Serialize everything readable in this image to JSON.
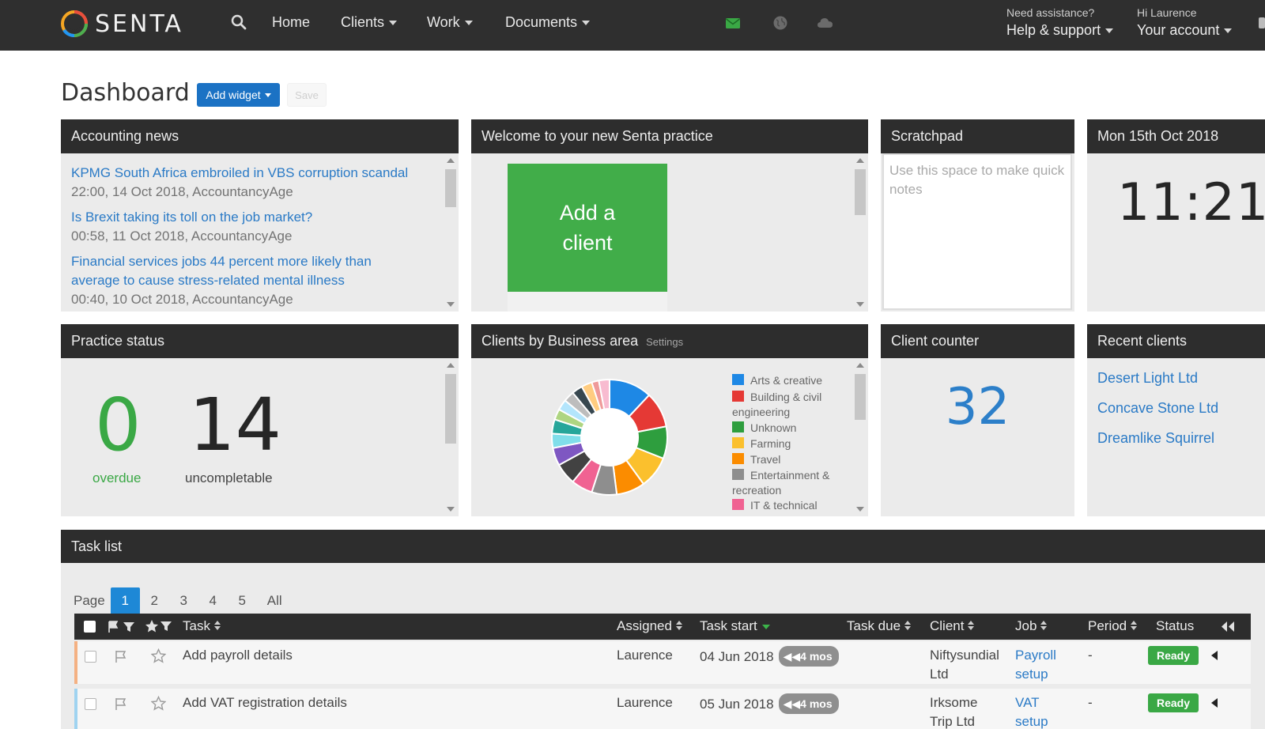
{
  "app": {
    "logo_text": "SENTA"
  },
  "nav": {
    "items": [
      {
        "label": "Home",
        "dropdown": false
      },
      {
        "label": "Clients",
        "dropdown": true
      },
      {
        "label": "Work",
        "dropdown": true
      },
      {
        "label": "Documents",
        "dropdown": true
      }
    ],
    "icons": [
      "search-icon",
      "mail-icon",
      "globe-icon",
      "cloud-icon"
    ],
    "help": {
      "small": "Need assistance?",
      "label": "Help & support"
    },
    "account": {
      "small": "Hi Laurence",
      "label": "Your account"
    }
  },
  "dashboard": {
    "title": "Dashboard",
    "add_widget_label": "Add widget",
    "save_label": "Save"
  },
  "accounting_news": {
    "title": "Accounting news",
    "items": [
      {
        "headline": "KPMG South Africa embroiled in VBS corruption scandal",
        "meta": "22:00, 14 Oct 2018, AccountancyAge"
      },
      {
        "headline": "Is Brexit taking its toll on the job market?",
        "meta": "00:58, 11 Oct 2018, AccountancyAge"
      },
      {
        "headline": "Financial services jobs 44 percent more likely than average to cause stress-related mental illness",
        "meta": "00:40, 10 Oct 2018, AccountancyAge"
      }
    ]
  },
  "welcome": {
    "title": "Welcome to your new Senta practice",
    "add_client_label": "Add a client"
  },
  "scratchpad": {
    "title": "Scratchpad",
    "placeholder": "Use this space to make quick notes"
  },
  "clock": {
    "date": "Mon 15th Oct 2018",
    "time": "11:21"
  },
  "practice_status": {
    "title": "Practice status",
    "overdue_count": "0",
    "overdue_label": "overdue",
    "uncompletable_count": "14",
    "uncompletable_label": "uncompletable",
    "colors": {
      "overdue": "#3aa845"
    }
  },
  "clients_by_area": {
    "title": "Clients by Business area",
    "settings_label": "Settings",
    "legend": [
      {
        "label": "Arts & creative",
        "color": "#1e88e5"
      },
      {
        "label": "Building & civil engineering",
        "color": "#e53935"
      },
      {
        "label": "Unknown",
        "color": "#2e9e3e"
      },
      {
        "label": "Farming",
        "color": "#fbc02d"
      },
      {
        "label": "Travel",
        "color": "#fb8c00"
      },
      {
        "label": "Entertainment & recreation",
        "color": "#8e8e8e"
      },
      {
        "label": "IT & technical",
        "color": "#f06292"
      }
    ]
  },
  "chart_data": {
    "type": "pie",
    "donut": true,
    "legend_position": "right",
    "slices": [
      {
        "color": "#1e88e5",
        "value": 12
      },
      {
        "color": "#e53935",
        "value": 10
      },
      {
        "color": "#2e9e3e",
        "value": 9
      },
      {
        "color": "#fbc02d",
        "value": 9
      },
      {
        "color": "#fb8c00",
        "value": 8
      },
      {
        "color": "#8e8e8e",
        "value": 7
      },
      {
        "color": "#f06292",
        "value": 6
      },
      {
        "color": "#424242",
        "value": 6
      },
      {
        "color": "#7e57c2",
        "value": 5
      },
      {
        "color": "#80deea",
        "value": 4
      },
      {
        "color": "#26a69a",
        "value": 4
      },
      {
        "color": "#aed581",
        "value": 3
      },
      {
        "color": "#b3e5fc",
        "value": 3
      },
      {
        "color": "#bdbdbd",
        "value": 3
      },
      {
        "color": "#37474f",
        "value": 3
      },
      {
        "color": "#ffcc80",
        "value": 3
      },
      {
        "color": "#ef9a9a",
        "value": 2
      },
      {
        "color": "#f8bbd0",
        "value": 3
      }
    ]
  },
  "client_counter": {
    "title": "Client counter",
    "count": "32"
  },
  "recent_clients": {
    "title": "Recent clients",
    "items": [
      "Desert Light Ltd",
      "Concave Stone Ltd",
      "Dreamlike Squirrel"
    ]
  },
  "task_list": {
    "title": "Task list",
    "page_label": "Page",
    "pages": [
      "1",
      "2",
      "3",
      "4",
      "5",
      "All"
    ],
    "active_page": "1",
    "columns": {
      "task": "Task",
      "assigned": "Assigned",
      "task_start": "Task start",
      "task_due": "Task due",
      "client": "Client",
      "job": "Job",
      "period": "Period",
      "status": "Status"
    },
    "rows": [
      {
        "task": "Add payroll details",
        "assigned": "Laurence",
        "task_start": "04 Jun 2018",
        "age": "4 mos",
        "task_due": "",
        "client_l1": "Niftysundial",
        "client_l2": "Ltd",
        "job_l1": "Payroll",
        "job_l2": "setup",
        "period": "-",
        "status": "Ready",
        "stripe": "#f4b183"
      },
      {
        "task": "Add VAT registration details",
        "assigned": "Laurence",
        "task_start": "05 Jun 2018",
        "age": "4 mos",
        "task_due": "",
        "client_l1": "Irksome",
        "client_l2": "Trip Ltd",
        "job_l1": "VAT",
        "job_l2": "setup",
        "period": "-",
        "status": "Ready",
        "stripe": "#9fd3f0"
      }
    ]
  }
}
